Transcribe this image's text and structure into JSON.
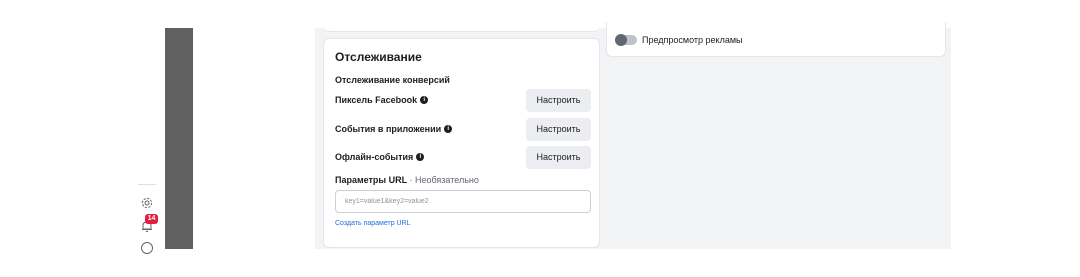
{
  "left_rail": {
    "notifications_count": "14"
  },
  "tracking": {
    "title": "Отслеживание",
    "conversion_section_title": "Отслеживание конверсий",
    "rows": [
      {
        "label": "Пиксель Facebook",
        "button": "Настроить"
      },
      {
        "label": "События в приложении",
        "button": "Настроить"
      },
      {
        "label": "Офлайн-события",
        "button": "Настроить"
      }
    ],
    "url_params": {
      "label": "Параметры URL",
      "optional": "· Необязательно",
      "placeholder": "key1=value1&key2=value2",
      "create_link": "Создать параметр URL"
    }
  },
  "ad_preview": {
    "label": "Предпросмотр рекламы",
    "enabled": false
  }
}
